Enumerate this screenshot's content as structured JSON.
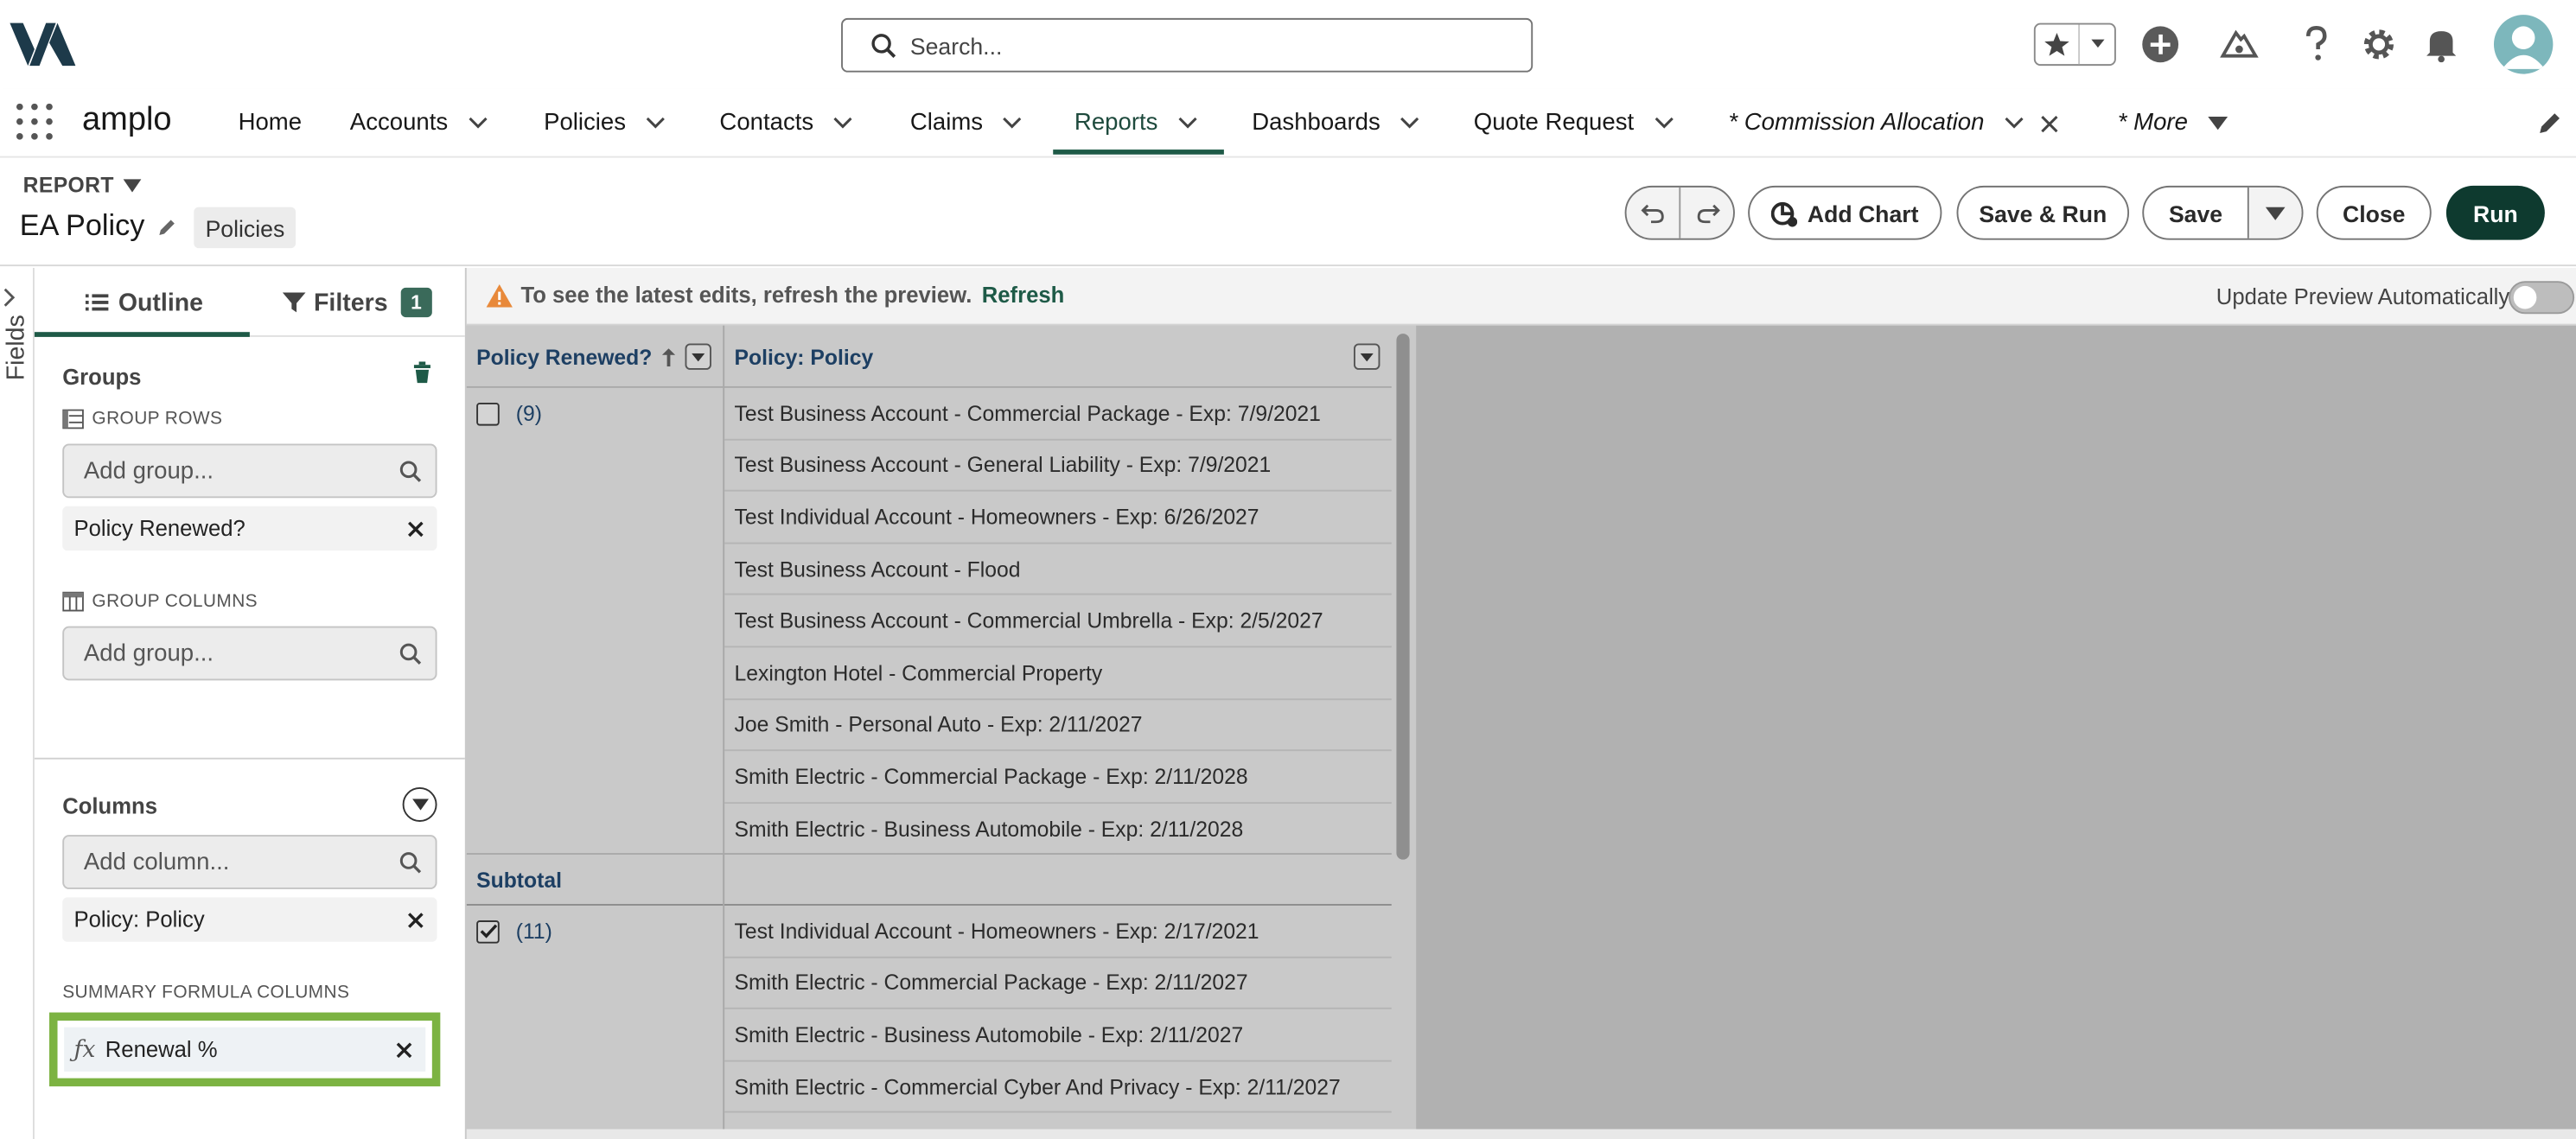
{
  "header": {
    "search_placeholder": "Search...",
    "icons": [
      "star-icon",
      "chevron-down-icon",
      "add-icon",
      "trailhead-icon",
      "help-icon",
      "settings-icon",
      "notifications-icon",
      "avatar"
    ]
  },
  "nav": {
    "app_name": "amplo",
    "items": [
      {
        "label": "Home"
      },
      {
        "label": "Accounts"
      },
      {
        "label": "Policies"
      },
      {
        "label": "Contacts"
      },
      {
        "label": "Claims"
      },
      {
        "label": "Reports"
      },
      {
        "label": "Dashboards"
      },
      {
        "label": "Quote Request"
      },
      {
        "label": "* Commission Allocation"
      },
      {
        "label": "* More"
      }
    ],
    "active": "Reports"
  },
  "report": {
    "type_label": "REPORT",
    "title": "EA Policy",
    "object_pill": "Policies",
    "buttons": {
      "add_chart": "Add Chart",
      "save_run": "Save & Run",
      "save": "Save",
      "close": "Close",
      "run": "Run"
    }
  },
  "fields_strip": {
    "label": "Fields"
  },
  "panel": {
    "tabs": {
      "outline": "Outline",
      "filters": "Filters",
      "filter_count": "1"
    },
    "groups_title": "Groups",
    "group_rows_label": "GROUP ROWS",
    "group_rows_placeholder": "Add group...",
    "group_rows_chip": "Policy Renewed?",
    "group_columns_label": "GROUP COLUMNS",
    "group_columns_placeholder": "Add group...",
    "columns_title": "Columns",
    "columns_placeholder": "Add column...",
    "columns_chip": "Policy: Policy",
    "summary_label": "SUMMARY FORMULA COLUMNS",
    "summary_chip": "Renewal %",
    "highlight_color": "#7cb342"
  },
  "preview": {
    "warning": "To see the latest edits, refresh the preview.",
    "refresh": "Refresh",
    "auto_label": "Update Preview Automatically",
    "auto_on": false,
    "col1_header": "Policy Renewed?",
    "col2_header": "Policy: Policy",
    "group1": {
      "count": "(9)",
      "checked": false
    },
    "group2": {
      "count": "(11)",
      "checked": true
    },
    "subtotal_label": "Subtotal",
    "rows_group1": [
      "Test Business Account - Commercial Package - Exp: 7/9/2021",
      "Test Business Account - General Liability - Exp: 7/9/2021",
      "Test Individual Account - Homeowners - Exp: 6/26/2027",
      "Test Business Account - Flood",
      "Test Business Account - Commercial Umbrella - Exp: 2/5/2027",
      "Lexington Hotel - Commercial Property",
      "Joe Smith - Personal Auto - Exp: 2/11/2027",
      "Smith Electric - Commercial Package - Exp: 2/11/2028",
      "Smith Electric - Business Automobile - Exp: 2/11/2028"
    ],
    "rows_group2": [
      "Test Individual Account - Homeowners - Exp: 2/17/2021",
      "Smith Electric - Commercial Package - Exp: 2/11/2027",
      "Smith Electric - Business Automobile - Exp: 2/11/2027",
      "Smith Electric - Commercial Cyber And Privacy - Exp: 2/11/2027"
    ]
  }
}
